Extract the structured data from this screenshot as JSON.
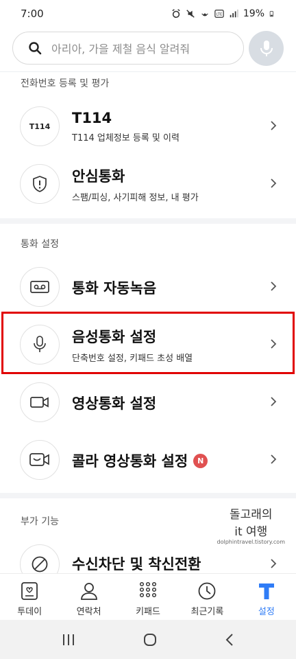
{
  "status_bar": {
    "time": "7:00",
    "battery": "19%"
  },
  "search": {
    "placeholder": "아리아, 가을 제철 음식 알려줘"
  },
  "sections": {
    "registration": {
      "title": "전화번호 등록 및 평가"
    },
    "call_settings": {
      "title": "통화 설정"
    },
    "extra": {
      "title": "부가 기능"
    }
  },
  "items": {
    "t114": {
      "icon_label": "T114",
      "title": "T114",
      "subtitle": "T114 업체정보 등록 및 이력"
    },
    "safe_call": {
      "title": "안심통화",
      "subtitle": "스팸/피싱, 사기피해 정보, 내 평가"
    },
    "auto_record": {
      "title": "통화 자동녹음"
    },
    "voice_call": {
      "title": "음성통화 설정",
      "subtitle": "단축번호 설정, 키패드 초성 배열"
    },
    "video_call": {
      "title": "영상통화 설정"
    },
    "colla_video": {
      "title": "콜라 영상통화 설정",
      "badge": "N"
    },
    "block_forward": {
      "title": "수신차단 및 착신전환"
    }
  },
  "watermark": {
    "line1": "돌고래의",
    "line2": "it 여행",
    "line3": "dolphintravel.tistory.com"
  },
  "bottom_nav": {
    "today": "투데이",
    "contacts": "연락처",
    "keypad": "키패드",
    "recent": "최근기록",
    "settings": "설정"
  },
  "colors": {
    "accent": "#2f7cf6",
    "highlight": "#e10000",
    "badge": "#e05151"
  }
}
